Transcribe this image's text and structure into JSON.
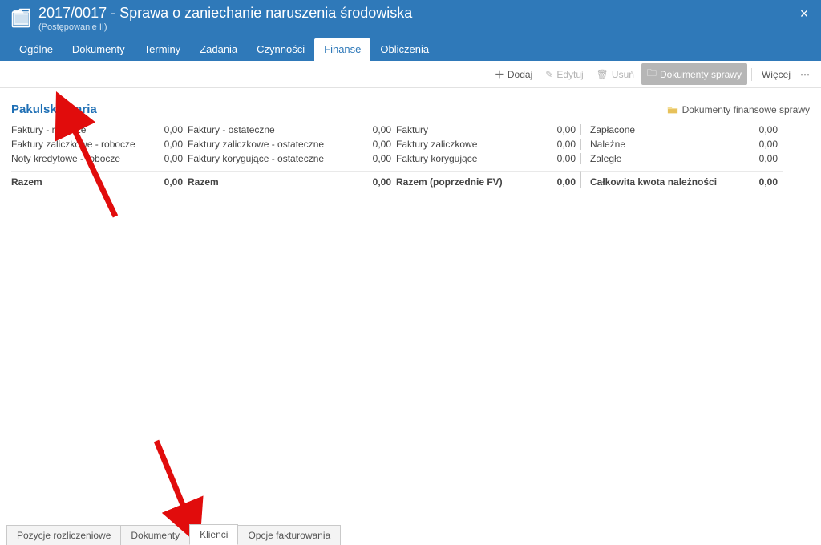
{
  "header": {
    "title": "2017/0017 - Sprawa o zaniechanie naruszenia środowiska",
    "subtitle": "(Postępowanie II)"
  },
  "nav": {
    "tabs": [
      "Ogólne",
      "Dokumenty",
      "Terminy",
      "Zadania",
      "Czynności",
      "Finanse",
      "Obliczenia"
    ],
    "active": "Finanse"
  },
  "toolbar": {
    "add": "Dodaj",
    "edit": "Edytuj",
    "delete": "Usuń",
    "case_docs": "Dokumenty sprawy",
    "more": "Więcej"
  },
  "client": {
    "name": "Pakulska Daria",
    "fin_docs_link": "Dokumenty finansowe sprawy"
  },
  "rows": {
    "col1": [
      {
        "label": "Faktury - robocze",
        "value": "0,00"
      },
      {
        "label": "Faktury zaliczkowe - robocze",
        "value": "0,00"
      },
      {
        "label": "Noty kredytowe - robocze",
        "value": "0,00"
      }
    ],
    "col2": [
      {
        "label": "Faktury - ostateczne",
        "value": "0,00"
      },
      {
        "label": "Faktury zaliczkowe - ostateczne",
        "value": "0,00"
      },
      {
        "label": "Faktury korygujące - ostateczne",
        "value": "0,00"
      }
    ],
    "col3": [
      {
        "label": "Faktury",
        "value": "0,00"
      },
      {
        "label": "Faktury zaliczkowe",
        "value": "0,00"
      },
      {
        "label": "Faktury korygujące",
        "value": "0,00"
      }
    ],
    "col4": [
      {
        "label": "Zapłacone",
        "value": "0,00"
      },
      {
        "label": "Należne",
        "value": "0,00"
      },
      {
        "label": "Zaległe",
        "value": "0,00"
      }
    ],
    "totals": {
      "t1_label": "Razem",
      "t1_value": "0,00",
      "t2_label": "Razem",
      "t2_value": "0,00",
      "t3_label": "Razem (poprzednie FV)",
      "t3_value": "0,00",
      "t4_label": "Całkowita kwota należności",
      "t4_value": "0,00"
    }
  },
  "bottom_tabs": {
    "items": [
      "Pozycje rozliczeniowe",
      "Dokumenty",
      "Klienci",
      "Opcje fakturowania"
    ],
    "active": "Klienci"
  }
}
